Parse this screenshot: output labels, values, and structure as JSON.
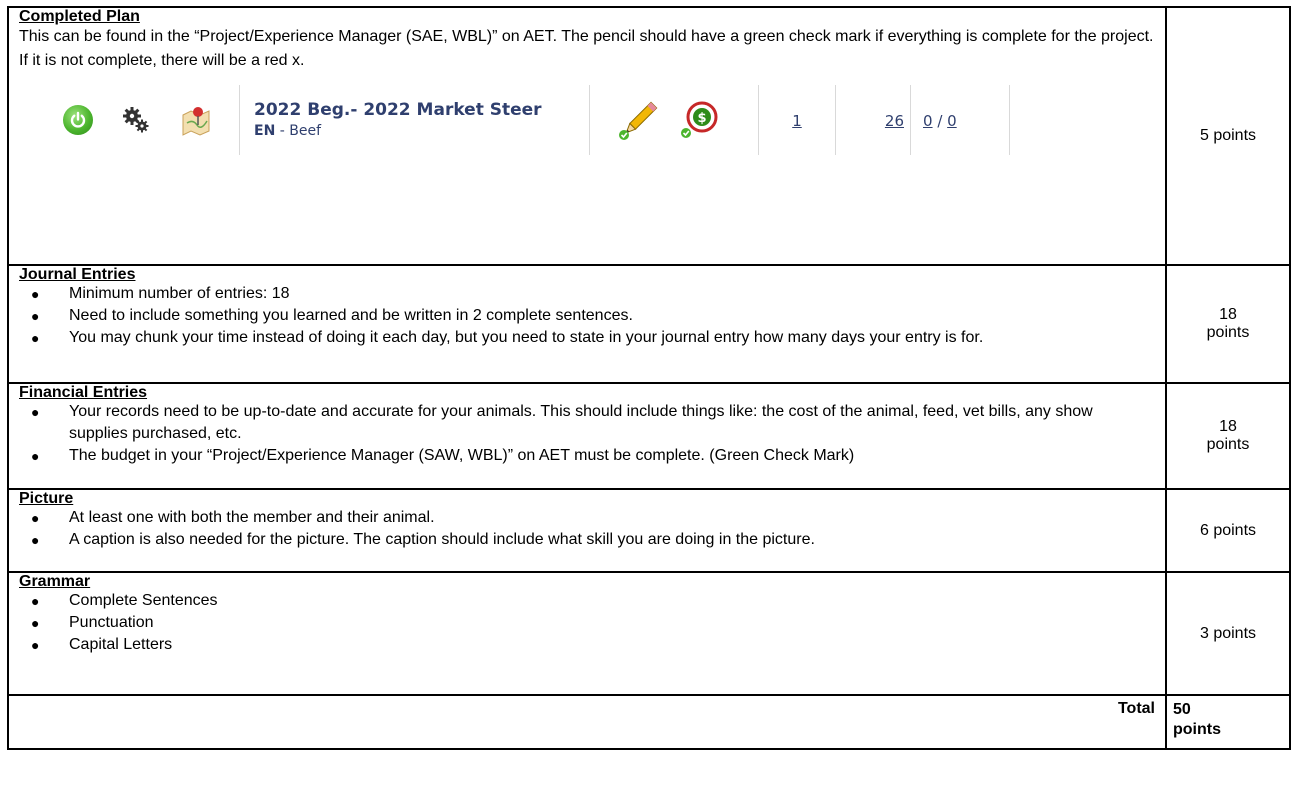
{
  "sections": [
    {
      "heading": "Completed Plan",
      "text": "This can be found in the “Project/Experience Manager (SAE, WBL)” on AET. The pencil should have a green check mark if everything is complete for the project. If it is not complete, there will be a red x.",
      "points": "5 points"
    },
    {
      "heading": "Journal Entries",
      "bullets": [
        "Minimum number of entries: 18",
        "Need to include something you learned and be written in 2 complete sentences.",
        "You may chunk your time instead of doing it each day, but you need to state in your journal entry how many days your entry is for."
      ],
      "points_line1": "18",
      "points_line2": "points"
    },
    {
      "heading": "Financial Entries",
      "bullets": [
        "Your records need to be up-to-date and accurate for your animals. This should include things like: the cost of the animal, feed, vet bills, any show supplies purchased, etc.",
        "The budget in your “Project/Experience Manager (SAW, WBL)” on AET must be complete. (Green Check Mark)"
      ],
      "points_line1": "18",
      "points_line2": "points"
    },
    {
      "heading": "Picture",
      "bullets": [
        "At least one with both the member and their animal.",
        "A caption is also needed for the picture. The caption should include what skill you are doing in the picture."
      ],
      "points": "6 points"
    },
    {
      "heading": "Grammar",
      "bullets": [
        "Complete Sentences",
        "Punctuation",
        "Capital Letters"
      ],
      "points": "3 points"
    }
  ],
  "bullet_glyph": "●",
  "aet_project": {
    "title": "2022 Beg.- 2022 Market Steer",
    "category_code": "EN",
    "category_rest": " - Beef",
    "count_1": "1",
    "count_2": "26",
    "count_3a": "0",
    "count_sep": " / ",
    "count_3b": "0",
    "icons": [
      "power-icon",
      "gears-icon",
      "map-pin-icon",
      "pencil-check-icon",
      "money-check-icon"
    ],
    "colors": {
      "text": "#2f3f6e",
      "green": "#4cb52e",
      "red": "#c62828"
    }
  },
  "total": {
    "label": "Total",
    "points_line1": "50",
    "points_line2": "points"
  }
}
